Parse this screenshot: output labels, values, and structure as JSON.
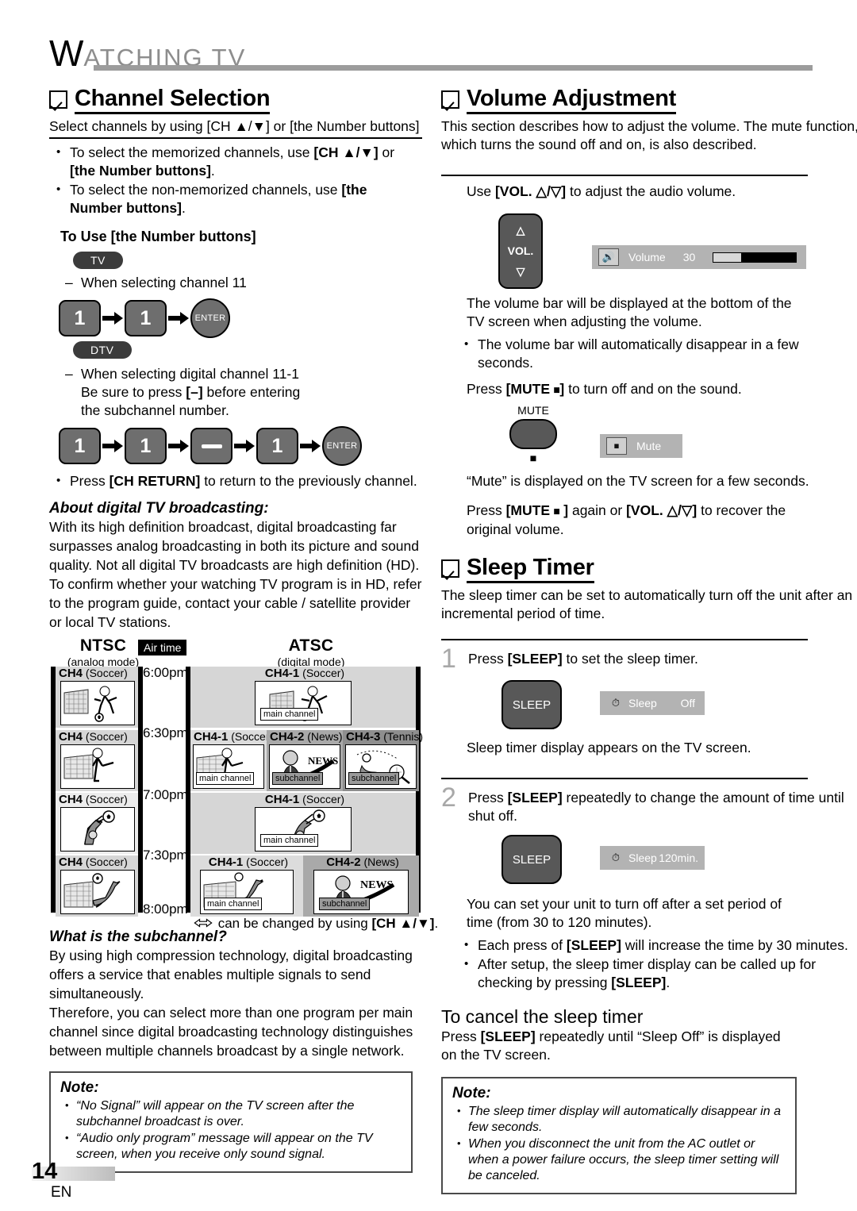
{
  "runhead": {
    "initial": "W",
    "rest": "ATCHING  TV"
  },
  "left": {
    "section1": {
      "title": "Channel Selection",
      "intro": "Select channels by using [CH ▲/▼] or [the Number buttons]",
      "bullets": [
        "To select the memorized channels, use [CH ▲/▼] or [the Number buttons].",
        "To select the non-memorized channels, use [the Number buttons]."
      ],
      "subhead": "To Use [the Number buttons]",
      "tv_pill": "TV",
      "tv_line": "When selecting channel 11",
      "tv_keys": [
        "1",
        "1",
        "ENTER"
      ],
      "dtv_pill": "DTV",
      "dtv_line1": "When selecting digital channel 11-1",
      "dtv_line2": "Be sure to press [–] before entering",
      "dtv_line3": "the subchannel number.",
      "dtv_keys": [
        "1",
        "1",
        "—",
        "1",
        "ENTER"
      ],
      "ch_return": "Press [CH RETURN] to return to the previously channel.",
      "about_head": "About digital TV broadcasting:",
      "about_body": "With its high definition broadcast, digital broadcasting far surpasses analog broadcasting in both its picture and sound quality. Not all digital TV broadcasts are high definition (HD). To confirm whether your watching TV program is in HD, refer to the program guide, contact your cable / satellite provider or local TV stations.",
      "subch_head": "What is the subchannel?",
      "subch_p1": "By using high compression technology, digital broadcasting offers a service that enables multiple signals to send simultaneously.",
      "subch_p2": "Therefore, you can select more than one program per main channel since digital broadcasting technology distinguishes between multiple channels broadcast by a single network.",
      "note": {
        "title": "Note:",
        "items": [
          "“No Signal” will appear on the TV screen after the subchannel broadcast is over.",
          "“Audio only program” message will appear on the TV screen, when you receive only sound signal."
        ]
      }
    },
    "diagram": {
      "ntsc_title": "NTSC",
      "ntsc_sub": "(analog mode)",
      "atsc_title": "ATSC",
      "atsc_sub": "(digital mode)",
      "airtime_label": "Air time",
      "times": [
        "6:00pm",
        "6:30pm",
        "7:00pm",
        "7:30pm",
        "8:00pm"
      ],
      "ntsc_cells": [
        {
          "ch": "CH4",
          "prog": "(Soccer)"
        },
        {
          "ch": "CH4",
          "prog": "(Soccer)"
        },
        {
          "ch": "CH4",
          "prog": "(Soccer)"
        },
        {
          "ch": "CH4",
          "prog": "(Soccer)"
        }
      ],
      "atsc_rows": [
        {
          "cells": [
            {
              "ch": "CH4-1",
              "prog": "(Soccer)",
              "tag": "main channel"
            }
          ]
        },
        {
          "cells": [
            {
              "ch": "CH4-1",
              "prog": "(Soccer)",
              "tag": "main channel"
            },
            {
              "ch": "CH4-2",
              "prog": "(News)",
              "tag": "subchannel"
            },
            {
              "ch": "CH4-3",
              "prog": "(Tennis)",
              "tag": "subchannel"
            }
          ]
        },
        {
          "cells": [
            {
              "ch": "CH4-1",
              "prog": "(Soccer)",
              "tag": "main channel"
            }
          ]
        },
        {
          "cells": [
            {
              "ch": "CH4-1",
              "prog": "(Soccer)",
              "tag": "main channel"
            },
            {
              "ch": "CH4-2",
              "prog": "(News)",
              "tag": "subchannel"
            }
          ]
        }
      ],
      "news_word": "NEWS",
      "footnote": "can be changed by using [CH ▲/▼]."
    }
  },
  "right": {
    "volume": {
      "title": "Volume Adjustment",
      "intro": "This section describes how to adjust the volume. The mute function, which turns the sound off and on, is also described.",
      "use_line": "Use [VOL. △/▽] to adjust the audio volume.",
      "vol_btn_label": "VOL.",
      "osd_volume": {
        "icon": "speaker-icon",
        "label": "Volume",
        "value": "30",
        "fill_percent": 35
      },
      "after_bar_1": "The volume bar will be displayed at the bottom of the TV screen when adjusting the volume.",
      "bullets": [
        "The volume bar will automatically disappear in a few seconds."
      ],
      "mute_line": "Press [MUTE ⌧] to turn off and on the sound.",
      "mute_btn_label": "MUTE",
      "osd_mute": {
        "icon": "mute-icon",
        "label": "Mute"
      },
      "mute_after": "“Mute” is displayed on the TV screen for a few seconds.",
      "recover": "Press [MUTE ⌧ ] again or [VOL. △/▽] to recover the original volume."
    },
    "sleep": {
      "title": "Sleep Timer",
      "intro": "The sleep timer can be set to automatically turn off the unit after an incremental period of time.",
      "step1_num": "1",
      "step1_text": "Press [SLEEP] to set the sleep timer.",
      "sleep_btn_label": "SLEEP",
      "osd_sleep_off": {
        "icon": "timer-icon",
        "label": "Sleep",
        "value": "Off"
      },
      "step1_after": "Sleep timer display appears on the TV screen.",
      "step2_num": "2",
      "step2_text": "Press [SLEEP] repeatedly to change the amount of time until shut off.",
      "osd_sleep_120": {
        "icon": "timer-icon",
        "label": "Sleep",
        "value": "120min."
      },
      "step2_after": "You can set your unit to turn off after a set period of time (from 30 to 120 minutes).",
      "bullets": [
        "Each press of [SLEEP] will increase the time by 30 minutes.",
        "After setup, the sleep timer display can be called up for checking by pressing [SLEEP]."
      ],
      "cancel_head": "To cancel the sleep timer",
      "cancel_body": "Press [SLEEP] repeatedly until “Sleep Off” is displayed on the TV screen.",
      "note": {
        "title": "Note:",
        "items": [
          "The sleep timer display will automatically disappear in a few seconds.",
          "When you disconnect the unit from the AC outlet or when a power failure occurs, the sleep timer setting will be canceled."
        ]
      }
    }
  },
  "footer": {
    "page_number": "14",
    "lang": "EN"
  }
}
